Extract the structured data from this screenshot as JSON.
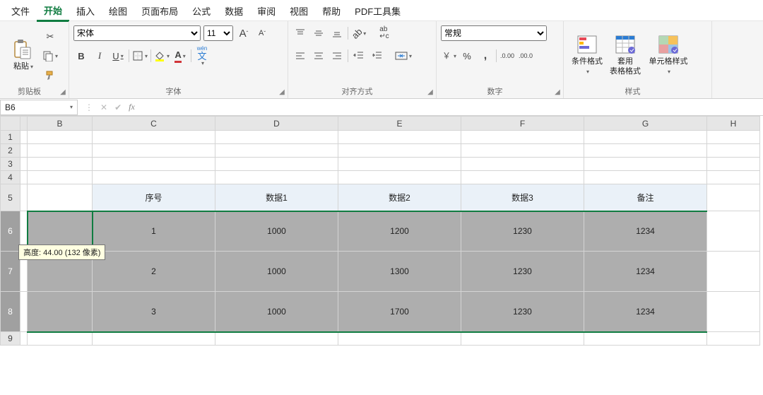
{
  "menu": {
    "tabs": [
      "文件",
      "开始",
      "插入",
      "绘图",
      "页面布局",
      "公式",
      "数据",
      "审阅",
      "视图",
      "帮助",
      "PDF工具集"
    ],
    "active_index": 1
  },
  "ribbon": {
    "clipboard": {
      "label": "剪贴板",
      "paste": "粘贴"
    },
    "font": {
      "label": "字体",
      "name": "宋体",
      "size": "11",
      "increase": "A",
      "decrease": "A",
      "bold": "B",
      "italic": "I",
      "underline": "U",
      "ruby": "wén"
    },
    "alignment": {
      "label": "对齐方式",
      "wrap": "ab"
    },
    "number": {
      "label": "数字",
      "format": "常规",
      "percent": "%",
      "comma": ",",
      "inc_dec": ".00",
      "dec_inc": ".00"
    },
    "styles": {
      "label": "样式",
      "conditional": "条件格式",
      "table_format": "套用\n表格格式",
      "cell_styles": "单元格样式"
    }
  },
  "formula_bar": {
    "reference": "B6",
    "fx": "fx",
    "value": ""
  },
  "tooltip": "高度: 44.00 (132 像素)",
  "columns": [
    "B",
    "C",
    "D",
    "E",
    "F",
    "G",
    "H"
  ],
  "row_headers": [
    "1",
    "2",
    "3",
    "4",
    "5",
    "6",
    "7",
    "8",
    "9"
  ],
  "selected_rows": [
    6,
    7,
    8
  ],
  "active_cell": "B6",
  "chart_data": {
    "type": "table",
    "title": "",
    "columns": [
      "序号",
      "数据1",
      "数据2",
      "数据3",
      "备注"
    ],
    "rows": [
      [
        "1",
        "1000",
        "1200",
        "1230",
        "1234"
      ],
      [
        "2",
        "1000",
        "1300",
        "1230",
        "1234"
      ],
      [
        "3",
        "1000",
        "1700",
        "1230",
        "1234"
      ]
    ]
  }
}
